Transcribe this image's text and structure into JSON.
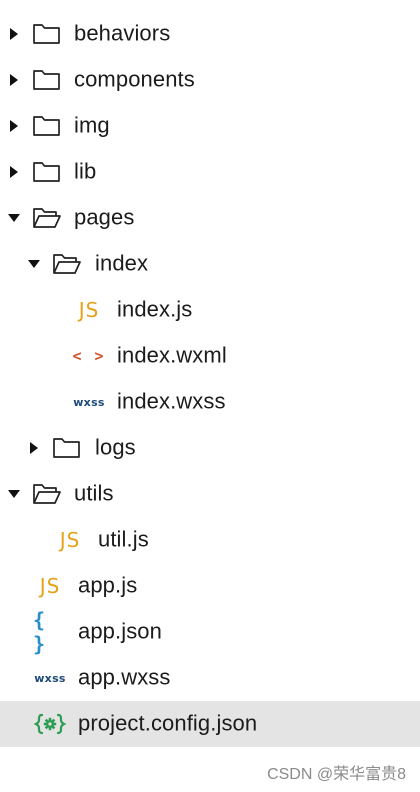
{
  "file_tree": {
    "rows": [
      {
        "label": "behaviors",
        "kind": "folder",
        "expanded": false,
        "depth": 0,
        "icon": "folder-icon"
      },
      {
        "label": "components",
        "kind": "folder",
        "expanded": false,
        "depth": 0,
        "icon": "folder-icon"
      },
      {
        "label": "img",
        "kind": "folder",
        "expanded": false,
        "depth": 0,
        "icon": "folder-icon"
      },
      {
        "label": "lib",
        "kind": "folder",
        "expanded": false,
        "depth": 0,
        "icon": "folder-icon"
      },
      {
        "label": "pages",
        "kind": "folder",
        "expanded": true,
        "depth": 0,
        "icon": "folder-open-icon"
      },
      {
        "label": "index",
        "kind": "folder",
        "expanded": true,
        "depth": 1,
        "icon": "folder-open-icon"
      },
      {
        "label": "index.js",
        "kind": "file",
        "depth": 2,
        "icon": "js-file-icon",
        "glyph": "JS"
      },
      {
        "label": "index.wxml",
        "kind": "file",
        "depth": 2,
        "icon": "wxml-file-icon",
        "glyph": "< >"
      },
      {
        "label": "index.wxss",
        "kind": "file",
        "depth": 2,
        "icon": "wxss-file-icon",
        "glyph": "wxss"
      },
      {
        "label": "logs",
        "kind": "folder",
        "expanded": false,
        "depth": 1,
        "icon": "folder-icon"
      },
      {
        "label": "utils",
        "kind": "folder",
        "expanded": true,
        "depth": 0,
        "icon": "folder-open-icon"
      },
      {
        "label": "util.js",
        "kind": "file",
        "depth": 1,
        "icon": "js-file-icon",
        "glyph": "JS"
      },
      {
        "label": "app.js",
        "kind": "file",
        "depth": 0,
        "icon": "js-file-icon",
        "glyph": "JS"
      },
      {
        "label": "app.json",
        "kind": "file",
        "depth": 0,
        "icon": "json-file-icon",
        "glyph": "{ }"
      },
      {
        "label": "app.wxss",
        "kind": "file",
        "depth": 0,
        "icon": "wxss-file-icon",
        "glyph": "wxss"
      },
      {
        "label": "project.config.json",
        "kind": "file",
        "depth": 0,
        "icon": "config-file-icon",
        "selected": true
      }
    ]
  },
  "watermark": {
    "text": "CSDN @荣华富贵8"
  },
  "colors": {
    "js": "#e6a21a",
    "wxml": "#d8502c",
    "wxss": "#1c4a7a",
    "json": "#2a8fc8",
    "config": "#2c9c52",
    "selected_row": "#e4e4e4"
  }
}
